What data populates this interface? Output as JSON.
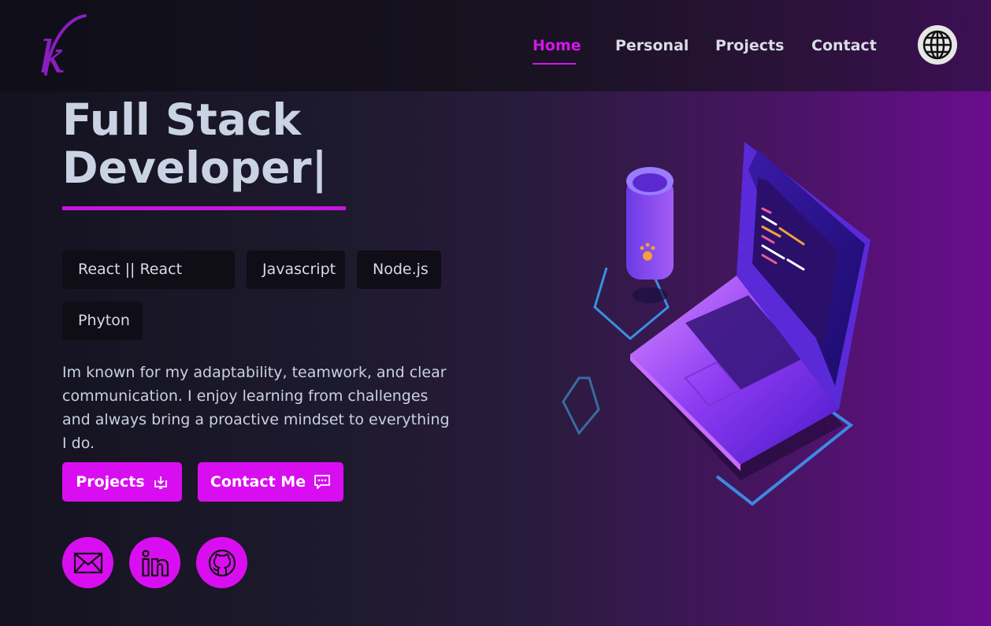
{
  "nav": {
    "logo_letter": "k",
    "links": [
      "Home",
      "Personal",
      "Projects",
      "Contact"
    ],
    "active": "Home",
    "language_icon": "globe-icon"
  },
  "hero": {
    "title": "Full Stack Developer|",
    "skills": [
      "React || React Native",
      "Javascript",
      "Node.js",
      "Phyton"
    ],
    "description": "Im known for my adaptability, teamwork, and clear communication. I enjoy learning from challenges and always bring a proactive mindset to everything I do.",
    "buttons": {
      "projects": {
        "label": "Projects",
        "icon": "download-icon"
      },
      "contact": {
        "label": "Contact Me",
        "icon": "chat-icon"
      }
    },
    "socials": [
      "mail-icon",
      "linkedin-icon",
      "github-icon"
    ]
  },
  "colors": {
    "accent": "#d90ef0",
    "title": "#c9d3e3",
    "skill_bg": "#0f0e16"
  }
}
